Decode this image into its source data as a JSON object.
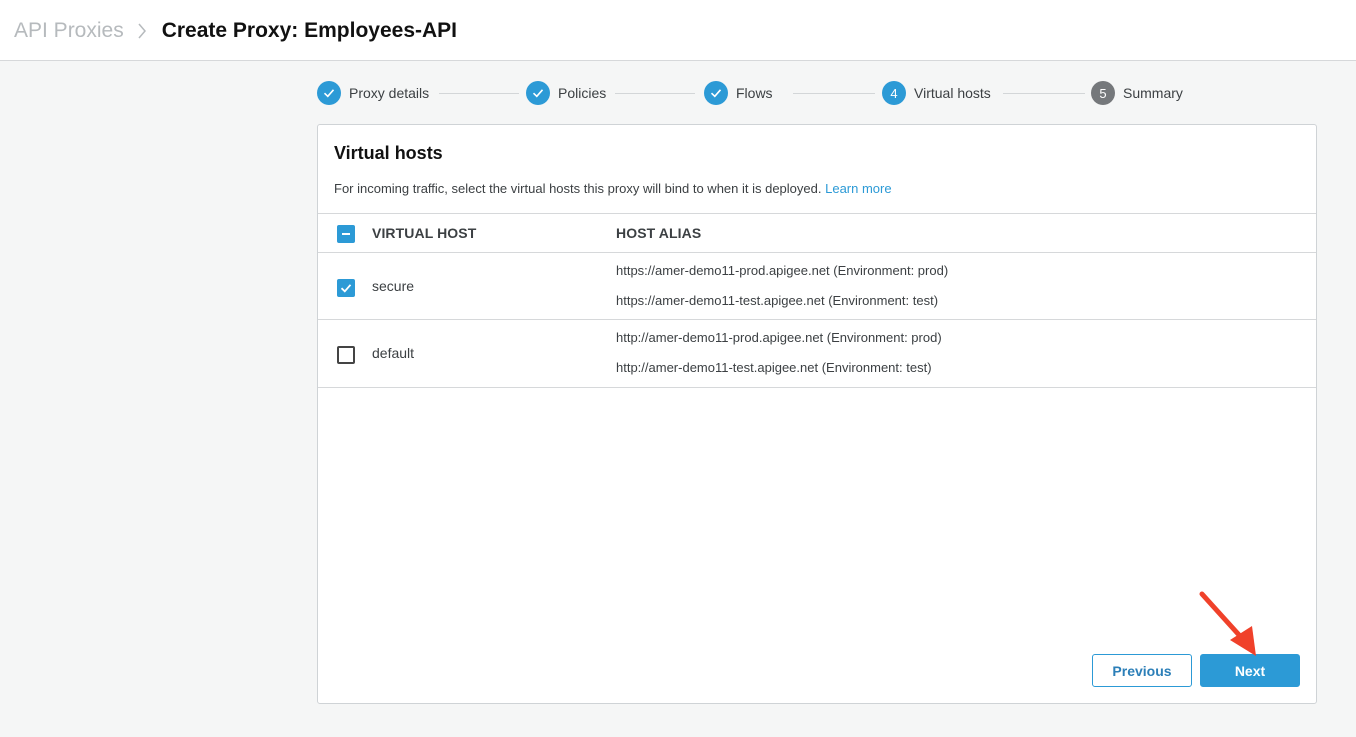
{
  "breadcrumb": {
    "root": "API Proxies",
    "current": "Create Proxy: Employees-API"
  },
  "stepper": {
    "steps": [
      {
        "number": "1",
        "label": "Proxy details",
        "state": "done"
      },
      {
        "number": "2",
        "label": "Policies",
        "state": "done"
      },
      {
        "number": "3",
        "label": "Flows",
        "state": "done"
      },
      {
        "number": "4",
        "label": "Virtual hosts",
        "state": "active"
      },
      {
        "number": "5",
        "label": "Summary",
        "state": "todo"
      }
    ]
  },
  "card": {
    "title": "Virtual hosts",
    "description": "For incoming traffic, select the virtual hosts this proxy will bind to when it is deployed.",
    "learn_more": "Learn more"
  },
  "table": {
    "headers": {
      "virtual_host": "VIRTUAL HOST",
      "host_alias": "HOST ALIAS"
    },
    "select_all_state": "indeterminate",
    "rows": [
      {
        "name": "secure",
        "checked": true,
        "aliases": [
          "https://amer-demo11-prod.apigee.net (Environment: prod)",
          "https://amer-demo11-test.apigee.net (Environment: test)"
        ]
      },
      {
        "name": "default",
        "checked": false,
        "aliases": [
          "http://amer-demo11-prod.apigee.net (Environment: prod)",
          "http://amer-demo11-test.apigee.net (Environment: test)"
        ]
      }
    ]
  },
  "buttons": {
    "previous": "Previous",
    "next": "Next"
  },
  "colors": {
    "accent": "#2c9ad6",
    "annotation_arrow": "#f0412a"
  }
}
